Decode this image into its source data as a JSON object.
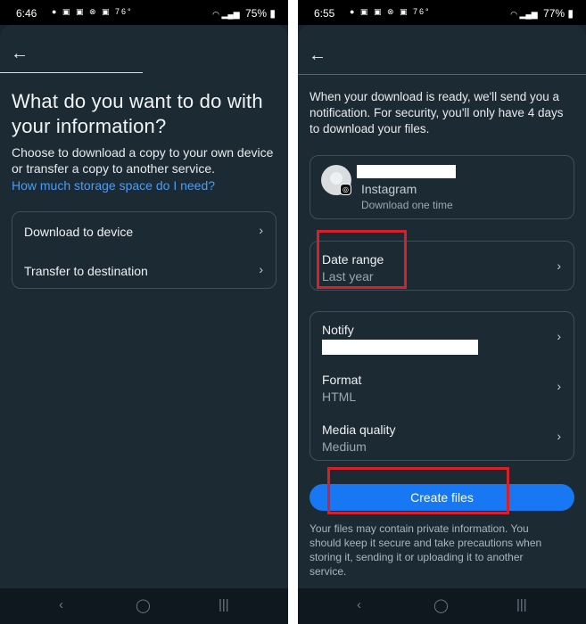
{
  "left": {
    "status": {
      "time": "6:46",
      "icons": "● ▣ ▣ ⊗ ▣",
      "temp": "76°",
      "battery": "75%"
    },
    "title": "What do you want to do with your information?",
    "description": "Choose to download a copy to your own device or transfer a copy to another service.",
    "link": "How much storage space do I need?",
    "options": [
      {
        "label": "Download to device"
      },
      {
        "label": "Transfer to destination"
      }
    ]
  },
  "right": {
    "status": {
      "time": "6:55",
      "icons": "● ▣ ▣ ⊗ ▣",
      "temp": "76°",
      "battery": "77%"
    },
    "description": "When your download is ready, we'll send you a notification. For security, you'll only have 4 days to download your files.",
    "account": {
      "app": "Instagram",
      "frequency": "Download one time"
    },
    "date_range": {
      "label": "Date range",
      "value": "Last year"
    },
    "settings": [
      {
        "label": "Notify",
        "value": ""
      },
      {
        "label": "Format",
        "value": "HTML"
      },
      {
        "label": "Media quality",
        "value": "Medium"
      }
    ],
    "create_button": "Create files",
    "footnote": "Your files may contain private information. You should keep it secure and take precautions when storing it, sending it or uploading it to another service."
  },
  "icons": {
    "back": "←",
    "chevron": "›",
    "nav_back": "‹",
    "nav_home": "◯",
    "nav_recents": "|||",
    "instagram": "◎"
  },
  "colors": {
    "background": "#1c2b33",
    "accent": "#1877f2",
    "link": "#4e9bf5",
    "highlight": "#d8202b"
  }
}
